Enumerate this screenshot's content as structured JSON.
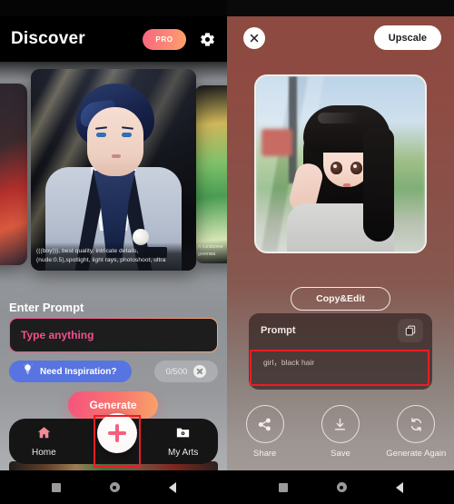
{
  "left_panel": {
    "header": {
      "title": "Discover",
      "pro_badge": "PRO",
      "settings_icon": "gear-icon"
    },
    "carousel": {
      "main_card_caption": "(((boy))), best quality, intricate details, (nude:0.5),spotlight, light rays, photoshoot, ultra",
      "right_card_caption": "A handsome greenwa"
    },
    "prompt_section": {
      "label": "Enter Prompt",
      "input_placeholder": "Type anything",
      "input_value": "",
      "inspiration_button": "Need Inspiration?",
      "inspiration_icon": "lightbulb-icon",
      "char_counter": "0/500",
      "clear_icon": "close-circle-icon",
      "generate_button": "Generate"
    },
    "tabbar": {
      "items": [
        {
          "label": "Home",
          "icon": "home-icon",
          "active": true
        },
        {
          "label": "My Arts",
          "icon": "folder-icon",
          "active": false
        }
      ],
      "fab_icon": "plus-icon"
    },
    "navbar": {
      "recents_icon": "square-icon",
      "home_icon": "circle-icon",
      "back_icon": "back-chevron-icon"
    }
  },
  "right_panel": {
    "header": {
      "close_icon": "close-icon",
      "upscale_button": "Upscale"
    },
    "result_image": "generated-art-anime-girl",
    "copy_edit_button": "Copy&Edit",
    "prompt_card": {
      "title": "Prompt",
      "copy_icon": "copy-icon",
      "value": "girl，black hair"
    },
    "actions": [
      {
        "label": "Share",
        "icon": "share-icon"
      },
      {
        "label": "Save",
        "icon": "download-icon"
      },
      {
        "label": "Generate Again",
        "icon": "refresh-icon"
      }
    ],
    "navbar": {
      "recents_icon": "square-icon",
      "home_icon": "circle-icon",
      "back_icon": "back-chevron-icon"
    }
  },
  "annotations": {
    "highlight_color": "#ec1c24",
    "boxes": [
      {
        "target": "add-button-fab"
      },
      {
        "target": "prompt-value-field"
      }
    ]
  },
  "colors": {
    "accent_pink": "#f4607e",
    "accent_orange": "#f9a36a",
    "inspire_blue": "#5774e0",
    "right_bg": "#8c4940"
  }
}
